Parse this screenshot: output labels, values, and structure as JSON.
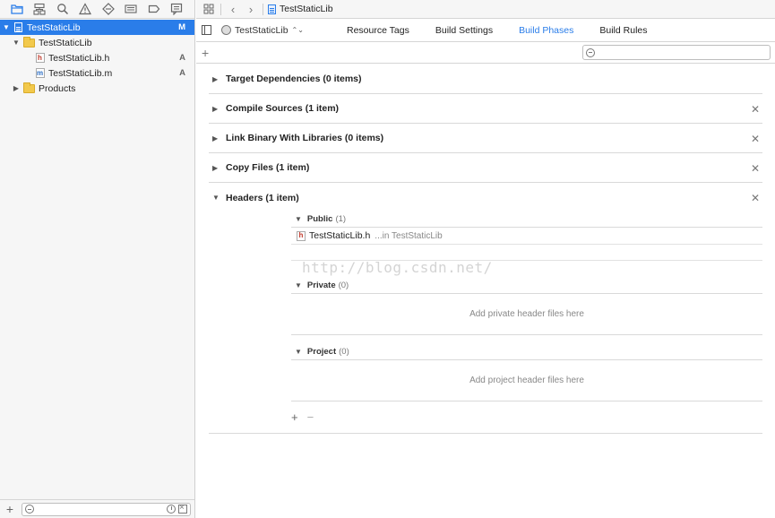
{
  "navigator": {
    "tree": [
      {
        "label": "TestStaticLib",
        "kind": "project",
        "expanded": true,
        "selected": true,
        "scm": "M"
      },
      {
        "label": "TestStaticLib",
        "kind": "folder",
        "expanded": true
      },
      {
        "label": "TestStaticLib.h",
        "kind": "header-file",
        "scm": "A"
      },
      {
        "label": "TestStaticLib.m",
        "kind": "source-file",
        "scm": "A"
      },
      {
        "label": "Products",
        "kind": "folder",
        "expanded": false
      }
    ],
    "filter_add": "+"
  },
  "jump_bar": {
    "crumb": "TestStaticLib"
  },
  "tabs": {
    "target": "TestStaticLib",
    "items": [
      {
        "label": "Resource Tags",
        "active": false
      },
      {
        "label": "Build Settings",
        "active": false
      },
      {
        "label": "Build Phases",
        "active": true
      },
      {
        "label": "Build Rules",
        "active": false
      }
    ]
  },
  "phase_toolbar": {
    "add": "+"
  },
  "phases": [
    {
      "title": "Target Dependencies (0 items)",
      "removable": false
    },
    {
      "title": "Compile Sources (1 item)",
      "removable": true
    },
    {
      "title": "Link Binary With Libraries (0 items)",
      "removable": true
    },
    {
      "title": "Copy Files (1 item)",
      "removable": true
    }
  ],
  "headers_phase": {
    "title": "Headers (1 item)",
    "public": {
      "name": "Public",
      "count": "(1)",
      "items": [
        {
          "file": "TestStaticLib.h",
          "path": "...in TestStaticLib"
        }
      ]
    },
    "private": {
      "name": "Private",
      "count": "(0)",
      "empty_text": "Add private header files here"
    },
    "project": {
      "name": "Project",
      "count": "(0)",
      "empty_text": "Add project header files here"
    },
    "footer_add": "+",
    "footer_remove": "−"
  },
  "watermark": "http://blog.csdn.net/",
  "colors": {
    "accent": "#2a7de9",
    "selection": "#2a7de9"
  }
}
